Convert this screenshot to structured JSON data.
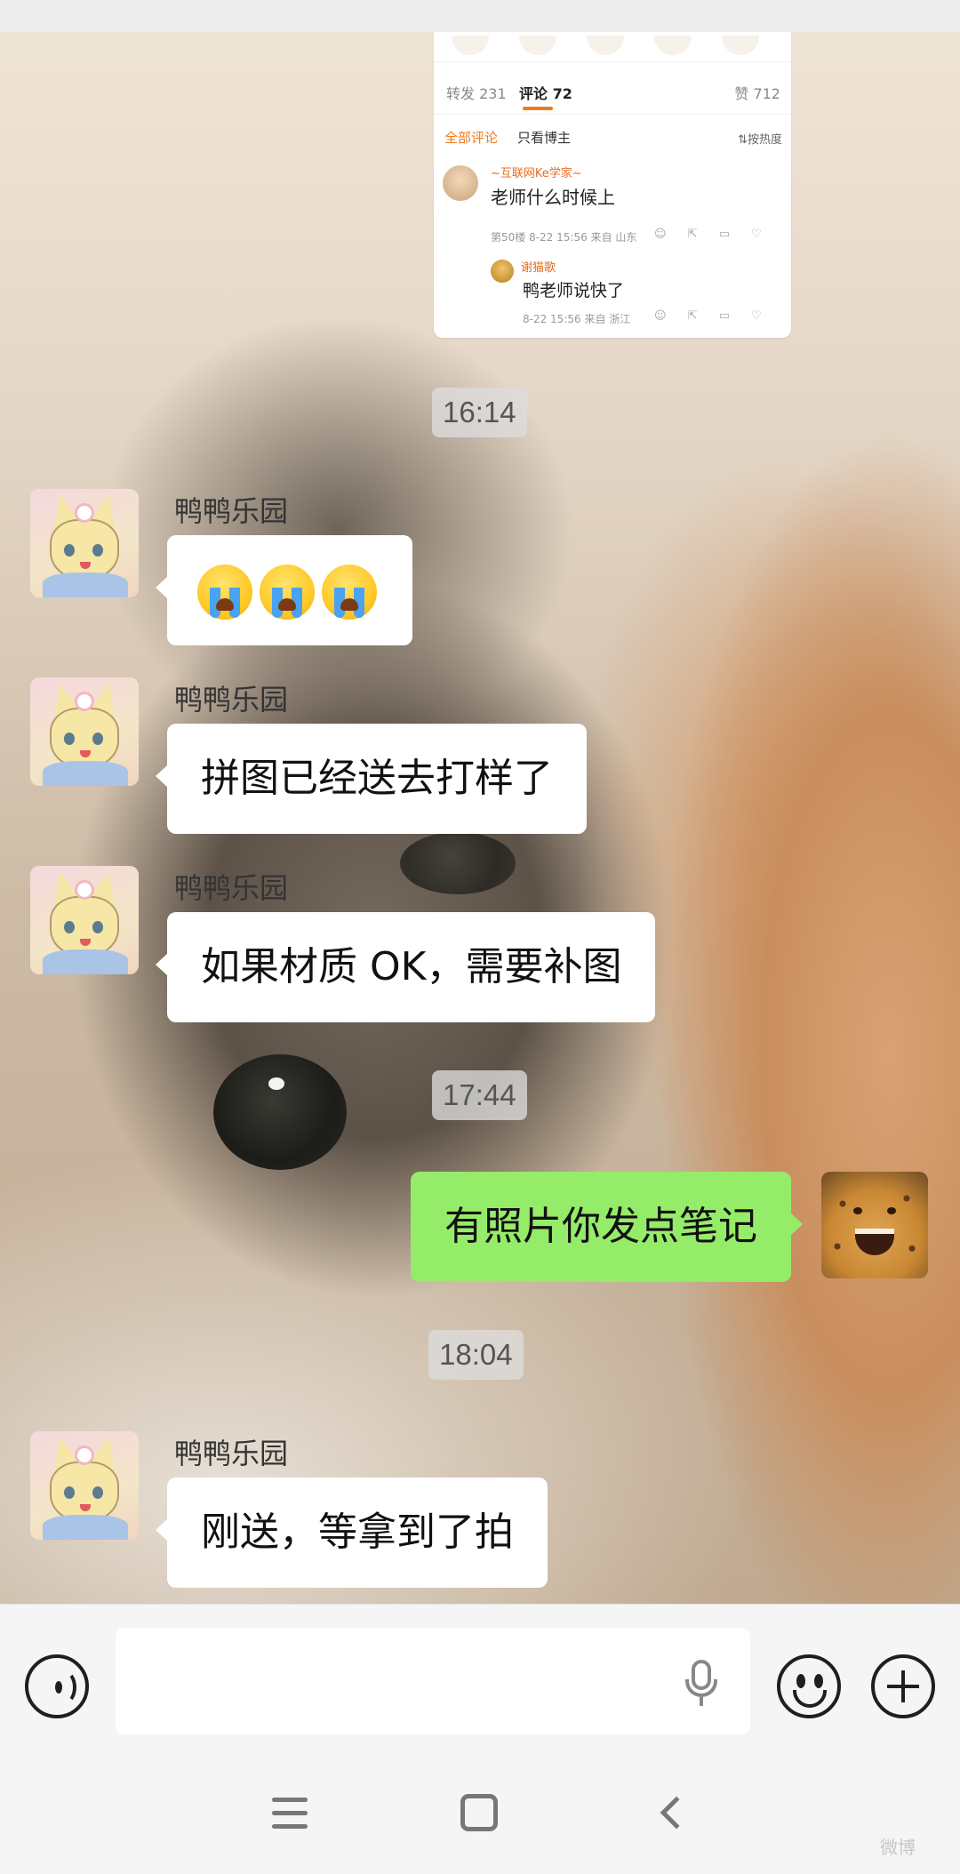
{
  "shared_post": {
    "tabs": {
      "reposts": "转发 231",
      "comments": "评论 72",
      "likes": "赞 712"
    },
    "filters": {
      "all": "全部评论",
      "author_only": "只看博主",
      "sort": "按热度"
    },
    "comment": {
      "user": "~互联网Ke学家~",
      "text": "老师什么时候上",
      "meta": "第50楼 8-22 15:56 来自 山东"
    },
    "reply": {
      "user": "谢猫歌",
      "text": "鸭老师说快了",
      "meta": "8-22 15:56 来自 浙江"
    }
  },
  "timestamps": [
    "16:14",
    "17:44",
    "18:04"
  ],
  "messages": [
    {
      "sender": "鸭鸭乐园",
      "type": "emoji",
      "emoji_name": "loudly-crying-face",
      "count": 3
    },
    {
      "sender": "鸭鸭乐园",
      "text": "拼图已经送去打样了"
    },
    {
      "sender": "鸭鸭乐园",
      "text": "如果材质 OK，需要补图"
    },
    {
      "sender": "self",
      "text": "有照片你发点笔记"
    },
    {
      "sender": "鸭鸭乐园",
      "text": "刚送，等拿到了拍"
    }
  ],
  "input_bar": {
    "voice_icon": "voice-mode-icon",
    "mic_icon": "microphone-icon",
    "emoji_icon": "emoji-icon",
    "plus_icon": "plus-icon"
  },
  "colors": {
    "self_bubble": "#95ec69",
    "other_bubble": "#ffffff",
    "comment_accent": "#e86d1f"
  },
  "watermark": "微博"
}
